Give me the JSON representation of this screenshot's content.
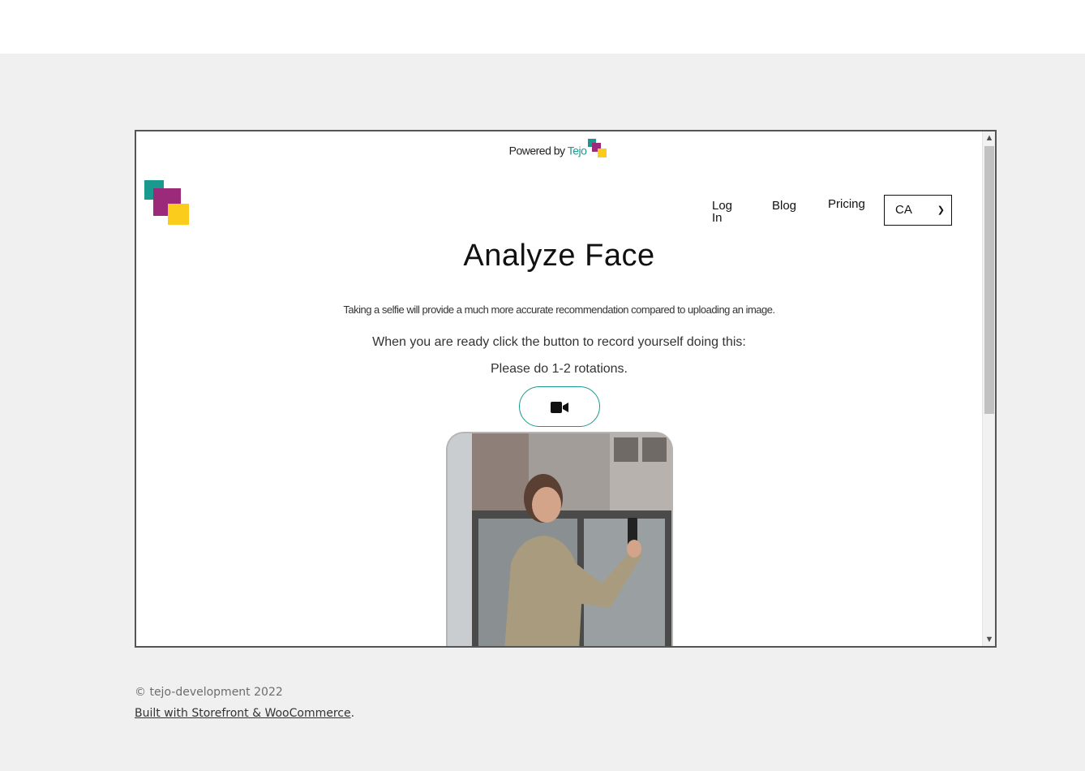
{
  "powered": {
    "prefix": "Powered by ",
    "brand": "Tejo"
  },
  "nav": {
    "login": "Log In",
    "blog": "Blog",
    "pricing": "Pricing",
    "country_selected": "CA"
  },
  "main": {
    "title": "Analyze Face",
    "subtitle": "Taking a selfie will provide a much more accurate recommendation compared to uploading an image.",
    "instruction": "When you are ready click the button to record yourself doing this:",
    "instruction2": "Please do 1-2 rotations."
  },
  "icons": {
    "record": "video-camera-icon",
    "logo": "tejo-logo",
    "scroll_up": "chevron-up-icon",
    "scroll_down": "chevron-down-icon"
  },
  "colors": {
    "teal": "#1a9a8f",
    "magenta": "#9b2a7a",
    "yellow": "#fccc1c",
    "page_bg": "#f0f0f0"
  },
  "footer": {
    "copyright": "© tejo-development 2022",
    "built_link": "Built with Storefront & WooCommerce",
    "built_suffix": "."
  }
}
